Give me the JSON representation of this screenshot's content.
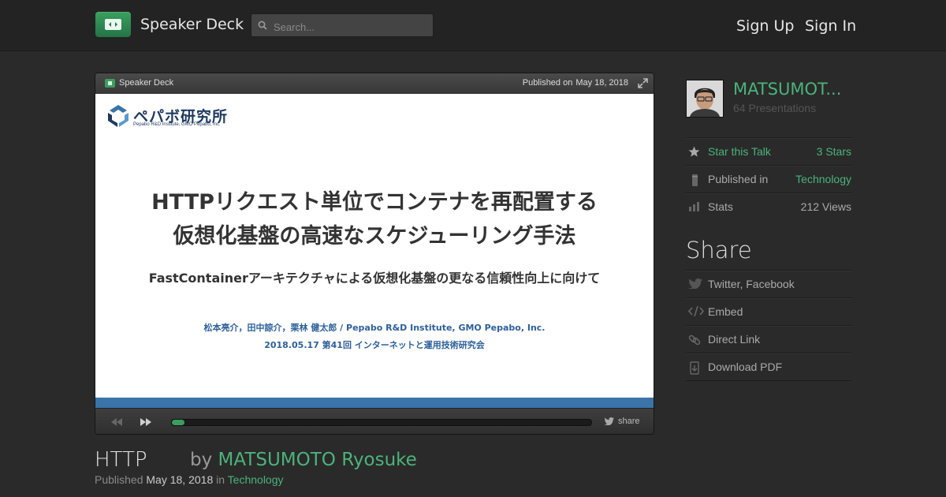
{
  "header": {
    "brand": "Speaker Deck",
    "search_placeholder": "Search...",
    "sign_up": "Sign Up",
    "sign_in": "Sign In"
  },
  "player": {
    "brand": "Speaker Deck",
    "published_prefix": "Published on",
    "published_date": "May 18, 2018",
    "share_label": "share",
    "progress_fraction": 0.03
  },
  "slide": {
    "logo_text": "ペパボ研究所",
    "logo_sub": "Pepabo R&D Institute, GMO Pepabo, Inc.",
    "title_line1": "HTTPリクエスト単位でコンテナを再配置する",
    "title_line2": "仮想化基盤の高速なスケジューリング手法",
    "subtitle": "FastContainerアーキテクチャによる仮想化基盤の更なる信頼性向上に向けて",
    "authors": "松本亮介，田中諒介，栗林 健太郎 / Pepabo R&D Institute, GMO Pepabo, Inc.",
    "event": "2018.05.17 第41回 インターネットと運用技術研究会"
  },
  "talk": {
    "title": "HTTP",
    "by_prefix": "by",
    "author": "MATSUMOTO Ryosuke",
    "published_prefix": "Published",
    "date": "May 18, 2018",
    "in_word": "in",
    "category": "Technology"
  },
  "sidebar": {
    "author_name": "MATSUMOT...",
    "presentations": "64 Presentations",
    "rows": [
      {
        "label": "Star this Talk",
        "value": "3 Stars",
        "icon": "star-icon"
      },
      {
        "label": "Published in",
        "value": "Technology",
        "icon": "bookmark-icon"
      },
      {
        "label": "Stats",
        "value": "212 Views",
        "icon": "bar-chart-icon"
      }
    ],
    "share_heading": "Share",
    "share_items": [
      {
        "label": "Twitter, Facebook",
        "icon": "bird-icon"
      },
      {
        "label": "Embed",
        "icon": "code-icon"
      },
      {
        "label": "Direct Link",
        "icon": "link-icon"
      },
      {
        "label": "Download PDF",
        "icon": "download-icon"
      }
    ]
  },
  "colors": {
    "accent": "#4bb37b",
    "background": "#2a2a2a",
    "slide_band": "#3a74a8"
  }
}
